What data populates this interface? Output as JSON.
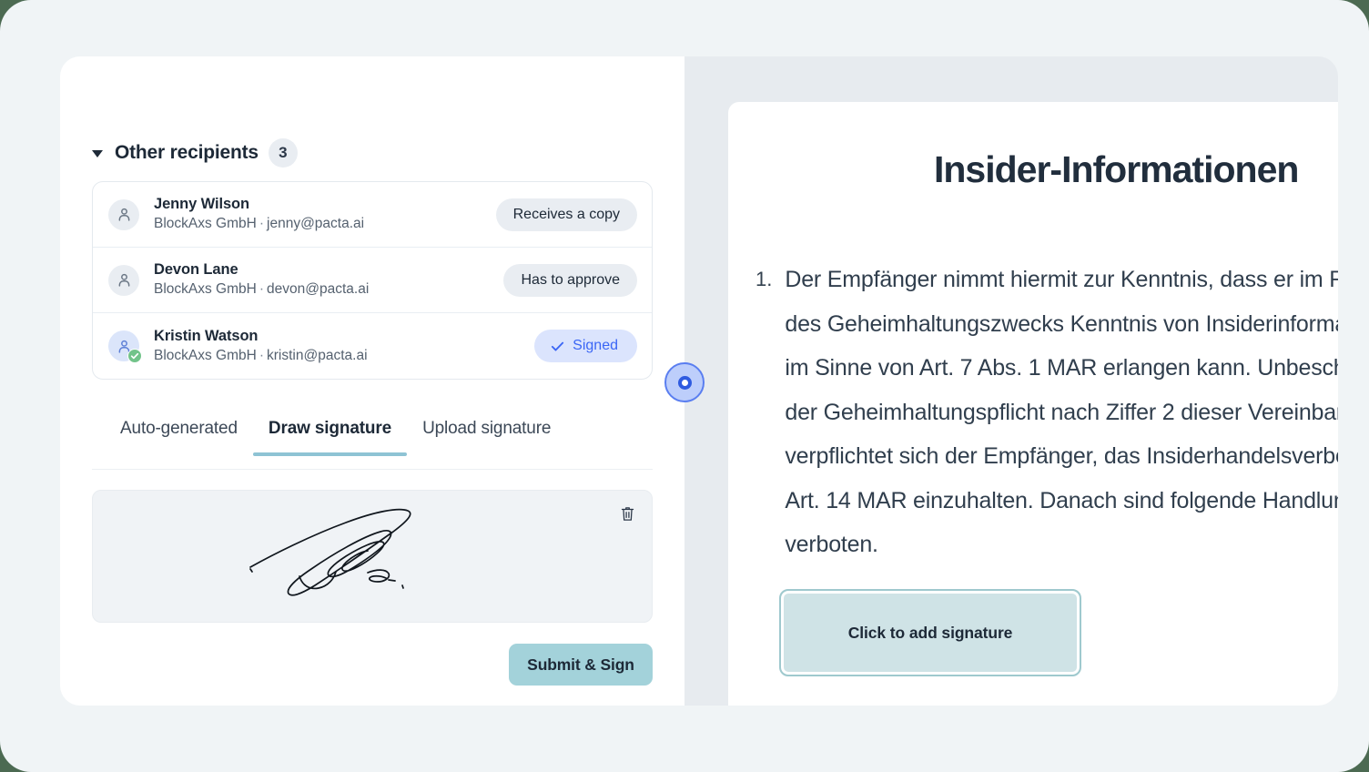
{
  "colors": {
    "outer_background": "#4c6a52",
    "app_background": "#f0f4f6",
    "right_pane_background": "#e7ebef",
    "accent_teal": "#a3d2da",
    "tab_underline": "#8ec3d4",
    "signed_badge_bg": "#dbe4fd",
    "signed_badge_text": "#3b66f5",
    "check_badge_green": "#72c38a",
    "handle_blue": "#2f5be0",
    "signature_field_fill": "#cfe3e6",
    "signature_field_border": "#9fc9ce"
  },
  "recipients_section": {
    "caret_icon": "caret-down-icon",
    "title": "Other recipients",
    "count": "3",
    "rows": [
      {
        "avatar_icon": "person-icon",
        "name": "Jenny Wilson",
        "company": "BlockAxs GmbH",
        "separator": "·",
        "email": "jenny@pacta.ai",
        "status": "Receives a copy",
        "status_kind": "neutral",
        "verified": false
      },
      {
        "avatar_icon": "person-icon",
        "name": "Devon Lane",
        "company": "BlockAxs GmbH",
        "separator": "·",
        "email": "devon@pacta.ai",
        "status": "Has to approve",
        "status_kind": "neutral",
        "verified": false
      },
      {
        "avatar_icon": "person-icon",
        "name": "Kristin Watson",
        "company": "BlockAxs GmbH",
        "separator": "·",
        "email": "kristin@pacta.ai",
        "status": "Signed",
        "status_kind": "signed",
        "status_icon": "check-icon",
        "verified": true,
        "verified_icon": "check-badge-icon"
      }
    ]
  },
  "signature_tabs": {
    "items": [
      {
        "label": "Auto-generated",
        "active": false
      },
      {
        "label": "Draw signature",
        "active": true
      },
      {
        "label": "Upload signature",
        "active": false
      }
    ]
  },
  "signature_pad": {
    "clear_icon": "trash-icon",
    "has_drawing": true
  },
  "actions": {
    "submit_label": "Submit & Sign"
  },
  "divider": {
    "handle_icon": "resize-handle-icon"
  },
  "document": {
    "title": "Insider-Informationen",
    "clauses": [
      {
        "marker": "1.",
        "text": "Der Empfänger nimmt hiermit zur Kenntnis, dass er im Rahmen\ndes Geheimhaltungszwecks Kenntnis von Insiderinformationen\nim Sinne von Art. 7 Abs. 1 MAR erlangen kann. Unbeschadet\nder Geheimhaltungspflicht nach Ziffer 2 dieser Vereinbarung\nverpflichtet sich der Empfänger, das Insiderhandelsverbot nach\nArt. 14 MAR einzuhalten. Danach sind folgende Handlungen\nverboten."
      }
    ],
    "signature_field": {
      "label": "Click to add signature"
    }
  }
}
